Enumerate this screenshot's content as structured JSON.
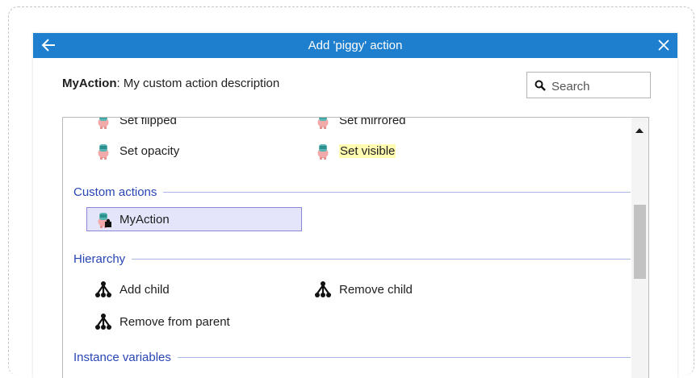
{
  "dialog": {
    "title": "Add 'piggy' action",
    "action_name": "MyAction",
    "action_description": ": My custom action description",
    "search_placeholder": "Search"
  },
  "list": {
    "top_partial": [
      "Set flipped",
      "Set mirrored"
    ],
    "top_row": [
      "Set opacity",
      "Set visible"
    ],
    "highlighted_item": "Set visible",
    "sections": [
      {
        "title": "Custom actions",
        "items": [
          "MyAction"
        ],
        "selected": "MyAction"
      },
      {
        "title": "Hierarchy",
        "items": [
          "Add child",
          "Remove child",
          "Remove from parent"
        ]
      }
    ],
    "bottom_partial_section": "Instance variables"
  },
  "icons": {
    "back": "arrow-left-icon",
    "close": "close-icon",
    "search": "magnifier-icon",
    "object": "piggy-sprite-icon",
    "custom": "piggy-custom-action-icon",
    "hierarchy": "hierarchy-tree-icon"
  },
  "colors": {
    "titlebar": "#1f7fcf",
    "section_heading": "#2845b4",
    "selection_fill": "#e4e5fb",
    "selection_border": "#8b87d6",
    "search_highlight": "#fffbb0"
  }
}
